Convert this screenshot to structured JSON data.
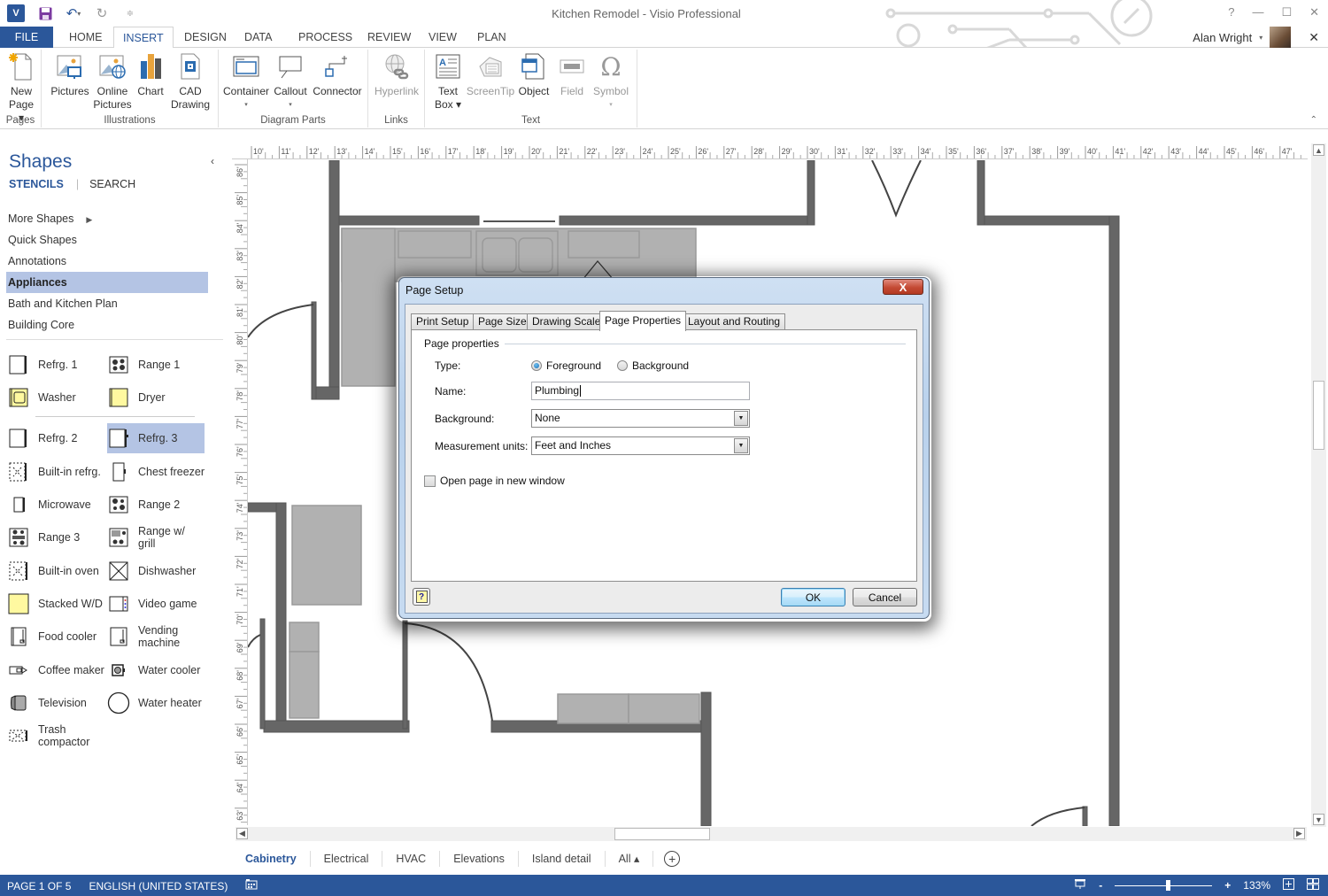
{
  "app": {
    "window_title": "Kitchen Remodel - Visio Professional",
    "logo_text": "V",
    "user_name": "Alan Wright",
    "window_controls": {
      "help": "?",
      "minimize": "—",
      "restore": "☐",
      "close": "✕",
      "close_doc": "✕"
    }
  },
  "ribbon": {
    "tabs": [
      {
        "label": "FILE"
      },
      {
        "label": "HOME"
      },
      {
        "label": "INSERT",
        "active": true
      },
      {
        "label": "DESIGN"
      },
      {
        "label": "DATA"
      },
      {
        "label": "PROCESS"
      },
      {
        "label": "REVIEW"
      },
      {
        "label": "VIEW"
      },
      {
        "label": "PLAN"
      }
    ],
    "groups": [
      {
        "label": "Pages",
        "buttons": [
          {
            "label": "New Page ▾",
            "icon": "new-page-icon"
          }
        ]
      },
      {
        "label": "Illustrations",
        "buttons": [
          {
            "label": "Pictures",
            "icon": "pictures-icon"
          },
          {
            "label": "Online Pictures",
            "icon": "online-pictures-icon"
          },
          {
            "label": "Chart",
            "icon": "chart-icon"
          },
          {
            "label": "CAD Drawing",
            "icon": "cad-drawing-icon"
          }
        ]
      },
      {
        "label": "Diagram Parts",
        "buttons": [
          {
            "label": "Container",
            "icon": "container-icon"
          },
          {
            "label": "Callout",
            "icon": "callout-icon"
          },
          {
            "label": "Connector",
            "icon": "connector-icon"
          }
        ]
      },
      {
        "label": "Links",
        "buttons": [
          {
            "label": "Hyperlink",
            "icon": "hyperlink-icon",
            "disabled": true
          }
        ]
      },
      {
        "label": "Text",
        "buttons": [
          {
            "label": "Text Box ▾",
            "icon": "text-box-icon"
          },
          {
            "label": "ScreenTip",
            "icon": "screentip-icon",
            "disabled": true
          },
          {
            "label": "Object",
            "icon": "object-icon"
          },
          {
            "label": "Field",
            "icon": "field-icon",
            "disabled": true
          },
          {
            "label": "Symbol",
            "icon": "symbol-icon",
            "disabled": true
          }
        ]
      }
    ]
  },
  "shapes_pane": {
    "title": "Shapes",
    "tabs": [
      "STENCILS",
      "SEARCH"
    ],
    "stencils": [
      {
        "label": "More Shapes",
        "has_arrow": true
      },
      {
        "label": "Quick Shapes"
      },
      {
        "label": "Annotations"
      },
      {
        "label": "Appliances",
        "active": true
      },
      {
        "label": "Bath and Kitchen Plan"
      },
      {
        "label": "Building Core"
      }
    ],
    "shapes": [
      {
        "label": "Refrg. 1",
        "icon": "refrigerator-icon"
      },
      {
        "label": "Range 1",
        "icon": "range-icon"
      },
      {
        "label": "Washer",
        "icon": "washer-icon"
      },
      {
        "label": "Dryer",
        "icon": "dryer-icon"
      },
      {
        "label": "Refrg. 2",
        "icon": "refrigerator-icon"
      },
      {
        "label": "Refrg. 3",
        "icon": "refrigerator-icon",
        "selected": true
      },
      {
        "label": "Built-in refrg.",
        "icon": "built-in-refrigerator-icon"
      },
      {
        "label": "Chest freezer",
        "icon": "chest-freezer-icon"
      },
      {
        "label": "Microwave",
        "icon": "microwave-icon"
      },
      {
        "label": "Range 2",
        "icon": "range-icon"
      },
      {
        "label": "Range 3",
        "icon": "range-icon"
      },
      {
        "label": "Range w/ grill",
        "icon": "range-grill-icon"
      },
      {
        "label": "Built-in oven",
        "icon": "built-in-oven-icon"
      },
      {
        "label": "Dishwasher",
        "icon": "dishwasher-icon"
      },
      {
        "label": "Stacked W/D",
        "icon": "stacked-washer-dryer-icon"
      },
      {
        "label": "Video game",
        "icon": "video-game-icon"
      },
      {
        "label": "Food cooler",
        "icon": "food-cooler-icon"
      },
      {
        "label": "Vending machine",
        "icon": "vending-machine-icon"
      },
      {
        "label": "Coffee maker",
        "icon": "coffee-maker-icon"
      },
      {
        "label": "Water cooler",
        "icon": "water-cooler-icon"
      },
      {
        "label": "Television",
        "icon": "television-icon"
      },
      {
        "label": "Water heater",
        "icon": "water-heater-icon"
      },
      {
        "label": "Trash compactor",
        "icon": "trash-compactor-icon"
      }
    ]
  },
  "rulers": {
    "top_labels": [
      "10'",
      "11'",
      "12'",
      "13'",
      "14'",
      "15'",
      "16'",
      "17'",
      "18'",
      "19'",
      "20'",
      "21'",
      "22'",
      "23'",
      "24'",
      "25'",
      "26'",
      "27'",
      "28'",
      "29'",
      "30'",
      "31'",
      "32'",
      "33'",
      "34'",
      "35'",
      "36'",
      "37'",
      "38'",
      "39'",
      "40'",
      "41'",
      "42'",
      "43'",
      "44'",
      "45'",
      "46'",
      "47'"
    ],
    "left_labels": [
      "86'",
      "85'",
      "84'",
      "83'",
      "82'",
      "81'",
      "80'",
      "79'",
      "78'",
      "77'",
      "76'",
      "75'",
      "74'",
      "73'",
      "72'",
      "71'",
      "70'",
      "69'",
      "68'",
      "67'",
      "66'",
      "65'",
      "64'",
      "63'"
    ]
  },
  "page_tabs": {
    "tabs": [
      {
        "label": "Cabinetry",
        "active": true
      },
      {
        "label": "Electrical"
      },
      {
        "label": "HVAC"
      },
      {
        "label": "Elevations"
      },
      {
        "label": "Island detail"
      },
      {
        "label": "All ▴"
      }
    ],
    "add_label": "+"
  },
  "statusbar": {
    "page": "PAGE 1 OF 5",
    "language": "ENGLISH (UNITED STATES)",
    "zoom_level": "133%",
    "zoom_fraction": 0.55,
    "zoom_minus": "-",
    "zoom_plus": "+"
  },
  "dialog": {
    "title": "Page Setup",
    "close_label": "X",
    "tabs": [
      {
        "label": "Print Setup"
      },
      {
        "label": "Page Size"
      },
      {
        "label": "Drawing Scale"
      },
      {
        "label": "Page Properties",
        "active": true
      },
      {
        "label": "Layout and Routing"
      }
    ],
    "section_label": "Page properties",
    "type_label": "Type:",
    "type_options": [
      {
        "label": "Foreground",
        "checked": true
      },
      {
        "label": "Background",
        "checked": false
      }
    ],
    "name_label": "Name:",
    "name_value": "Plumbing",
    "background_label": "Background:",
    "background_value": "None",
    "units_label": "Measurement units:",
    "units_value": "Feet and Inches",
    "open_new_window_label": "Open page in new window",
    "open_new_window_checked": false,
    "help_label": "?",
    "ok_label": "OK",
    "cancel_label": "Cancel"
  }
}
